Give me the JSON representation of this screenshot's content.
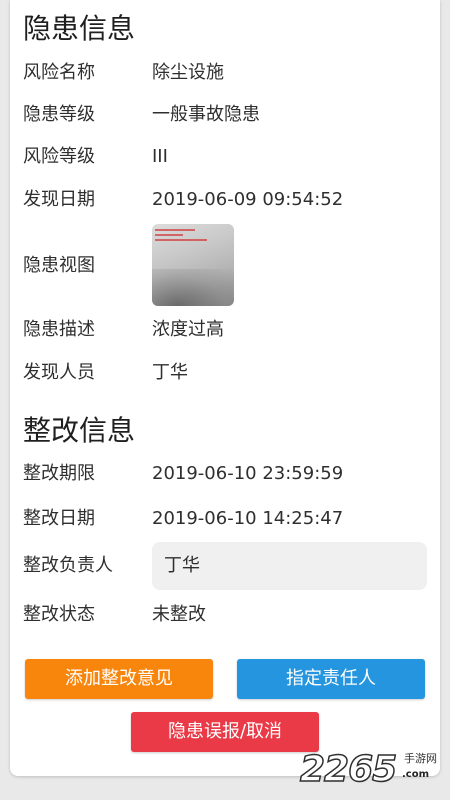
{
  "hazard_info": {
    "title": "隐患信息",
    "risk_name": {
      "label": "风险名称",
      "value": "除尘设施"
    },
    "hazard_level": {
      "label": "隐患等级",
      "value": "一般事故隐患"
    },
    "risk_level": {
      "label": "风险等级",
      "value": "III"
    },
    "found_date": {
      "label": "发现日期",
      "value": "2019-06-09 09:54:52"
    },
    "hazard_image": {
      "label": "隐患视图"
    },
    "description": {
      "label": "隐患描述",
      "value": "浓度过高"
    },
    "found_by": {
      "label": "发现人员",
      "value": "丁华"
    }
  },
  "rectify_info": {
    "title": "整改信息",
    "deadline": {
      "label": "整改期限",
      "value": "2019-06-10 23:59:59"
    },
    "rectify_date": {
      "label": "整改日期",
      "value": "2019-06-10 14:25:47"
    },
    "assignee": {
      "label": "整改负责人",
      "value": "丁华"
    },
    "status": {
      "label": "整改状态",
      "value": "未整改"
    }
  },
  "actions": {
    "add_opinion": "添加整改意见",
    "assign_person": "指定责任人",
    "false_report_cancel": "隐患误报/取消"
  },
  "watermark": {
    "logo": "2265",
    "sub": "手游网",
    "url": ".com"
  },
  "colors": {
    "add_opinion_button": "#f8860d",
    "assign_person_button": "#2495de",
    "cancel_button": "#ea3a48",
    "field_background": "#f0f0f0"
  }
}
